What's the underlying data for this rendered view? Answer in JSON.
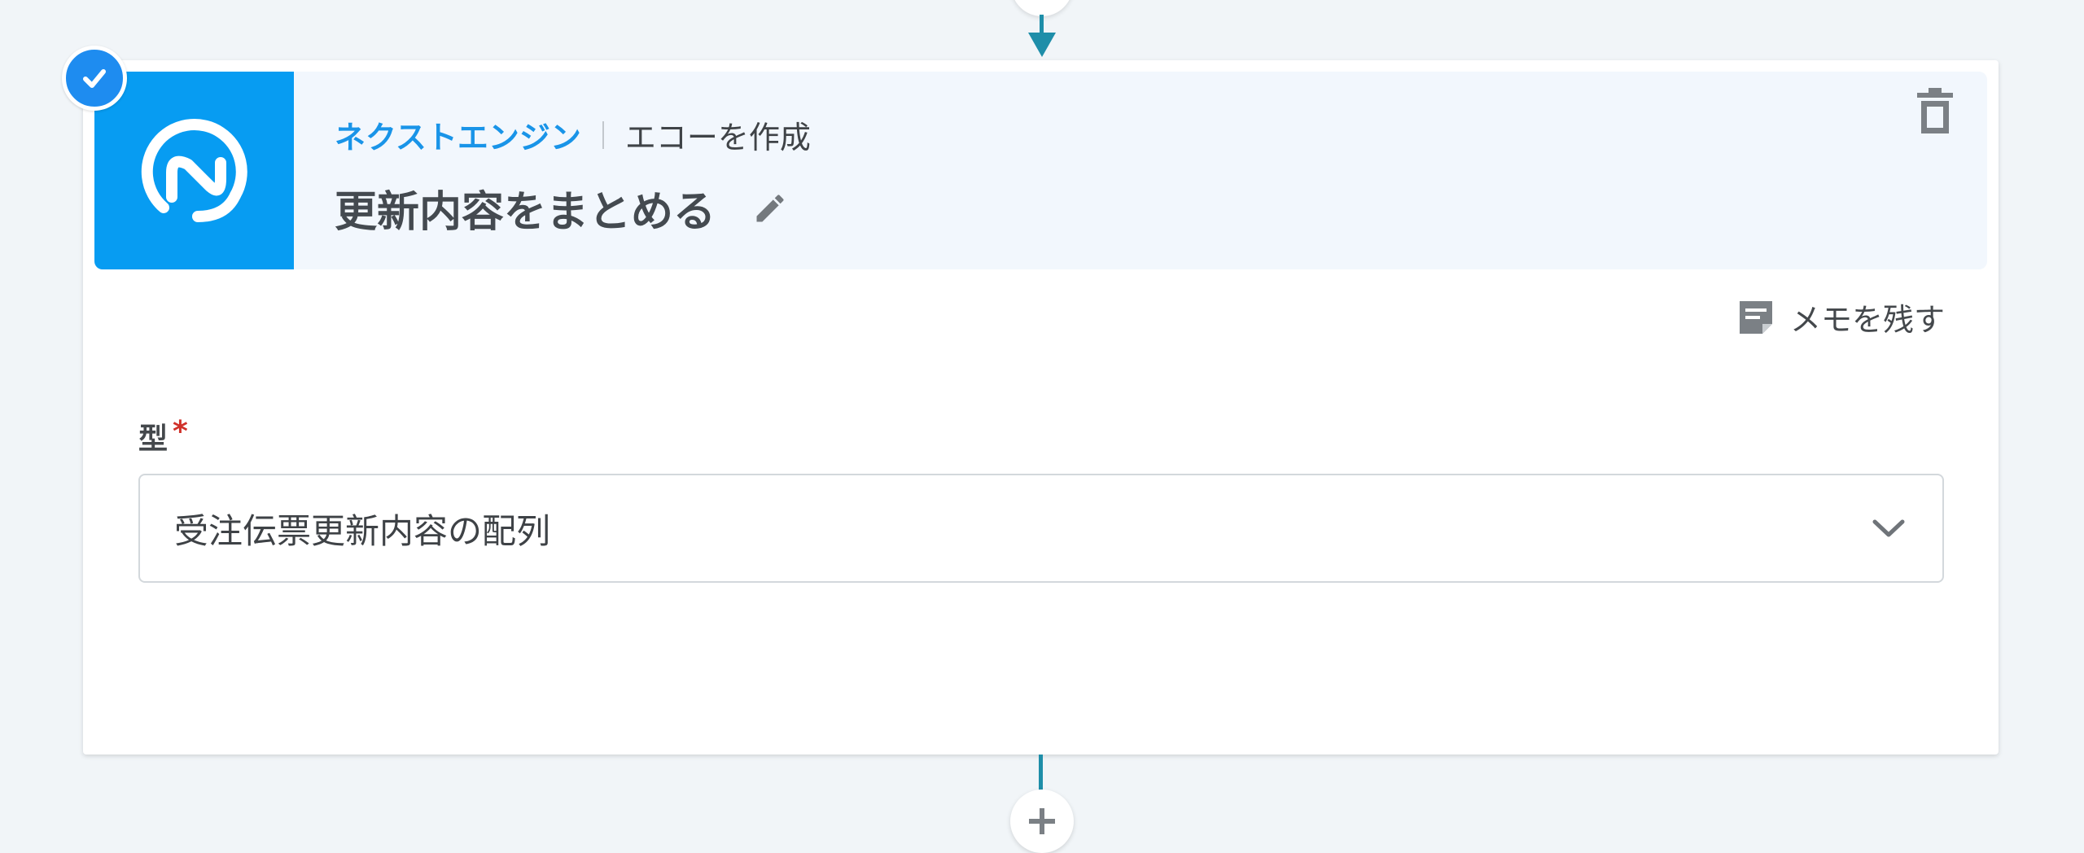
{
  "step": {
    "service_name": "ネクストエンジン",
    "action_name": "エコーを作成",
    "title": "更新内容をまとめる",
    "status": "completed"
  },
  "memo": {
    "label": "メモを残す"
  },
  "form": {
    "type_field": {
      "label": "型",
      "required_mark": "*",
      "selected_value": "受注伝票更新内容の配列"
    }
  },
  "colors": {
    "accent": "#1e8cf0",
    "logo_bg": "#079cf2",
    "connector": "#1e8ea9",
    "service_name": "#1994e8",
    "header_bg": "#f2f7fd",
    "page_bg": "#f1f5f8",
    "required": "#d0312a"
  },
  "icons": {
    "status": "check-icon",
    "logo": "next-engine-logo",
    "edit": "pencil-icon",
    "delete": "trash-icon",
    "memo": "note-icon",
    "dropdown": "chevron-down-icon",
    "add": "plus-icon"
  }
}
